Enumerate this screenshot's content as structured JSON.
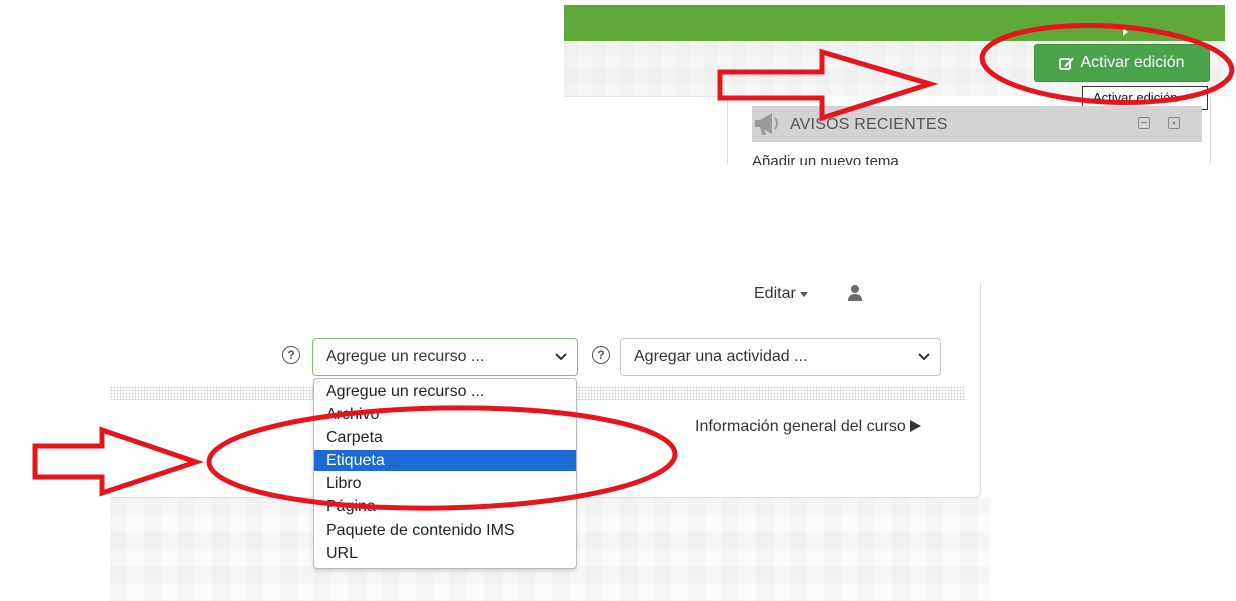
{
  "top_panel": {
    "edit_button_label": "Activar edición",
    "tooltip_text": "Activar edición",
    "block_title": "AVISOS RECIENTES",
    "block_link": "Añadir un nuevo tema"
  },
  "bottom_panel": {
    "edit_menu_label": "Editar",
    "resource_select": {
      "selected_value": "Agregue un recurso ...",
      "options": [
        "Agregue un recurso ...",
        "Archivo",
        "Carpeta",
        "Etiqueta",
        "Libro",
        "Página",
        "Paquete de contenido IMS",
        "URL"
      ],
      "highlighted_option": "Etiqueta"
    },
    "activity_select": {
      "selected_value": "Agregar una actividad ..."
    },
    "course_info_link": "Información general del curso"
  },
  "icons": {
    "edit_button": "edit-square-icon",
    "block": "megaphone-icon",
    "user": "user-icon",
    "help": "question-circle-icon",
    "select": "chevron-down-icon"
  },
  "colors": {
    "header_green": "#5fa83a",
    "button_green": "#4aa24a",
    "selected_option": "#1a6bd6",
    "annotation_red": "#e8141c"
  }
}
